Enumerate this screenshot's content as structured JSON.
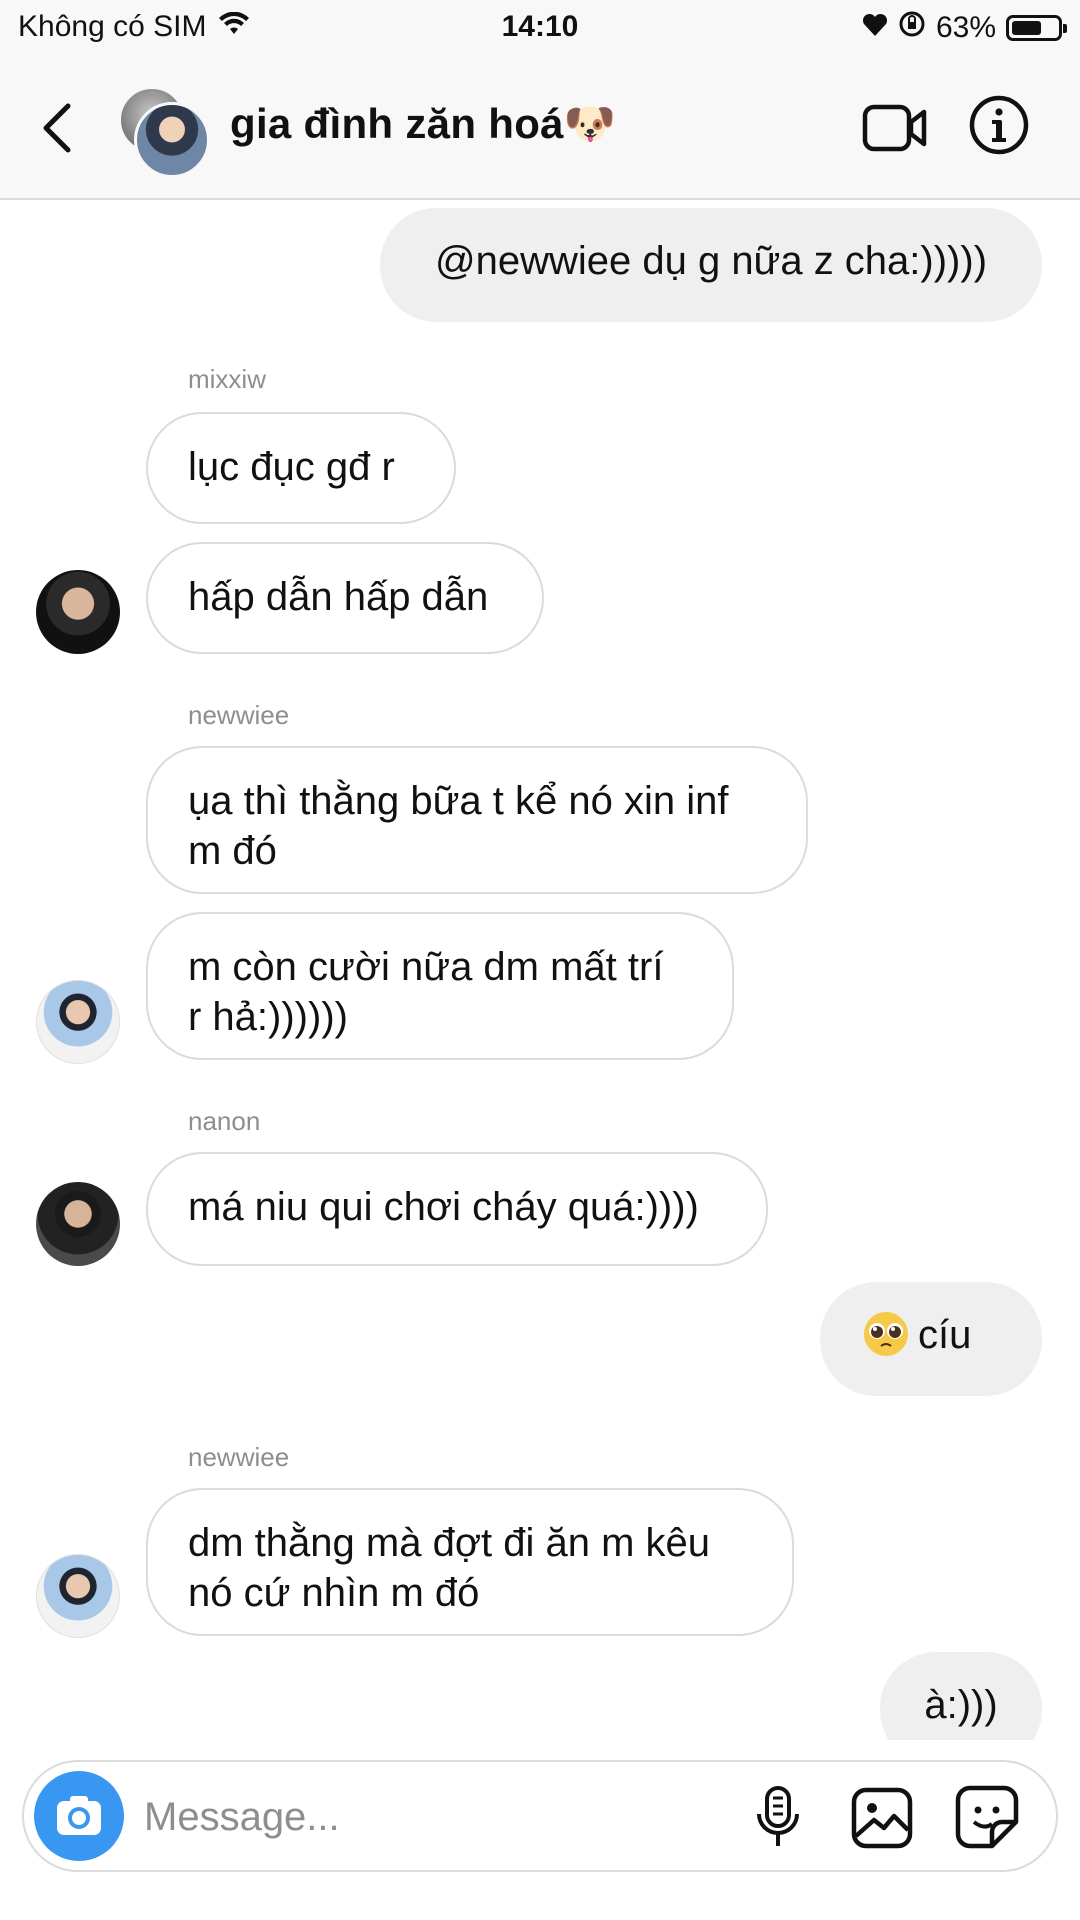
{
  "status_bar": {
    "carrier": "Không có SIM",
    "time": "14:10",
    "battery": "63%"
  },
  "header": {
    "title": "gia đình zăn hoá🐶",
    "icons": [
      "back-chevron-icon",
      "video-camera-icon",
      "info-icon"
    ]
  },
  "messages": [
    {
      "direction": "out",
      "text": "@newwiee dụ g nữa z cha:)))))"
    },
    {
      "sender": "mixxiw"
    },
    {
      "direction": "in",
      "text": "lục đục gđ r"
    },
    {
      "direction": "in",
      "text": "hấp dẫn hấp dẫn"
    },
    {
      "sender": "newwiee"
    },
    {
      "direction": "in",
      "lines": [
        "ụa thì thằng bữa t kể nó xin inf",
        "m đó"
      ]
    },
    {
      "direction": "in",
      "lines": [
        "m còn cười nữa dm mất trí",
        "r hả:))))))"
      ]
    },
    {
      "sender": "nanon"
    },
    {
      "direction": "in",
      "text": "má niu qui chơi cháy quá:))))"
    },
    {
      "direction": "out",
      "text": "cíu",
      "emoji": "pleading-face-emoji"
    },
    {
      "sender": "newwiee"
    },
    {
      "direction": "in",
      "lines": [
        "dm thằng mà đợt đi ăn m kêu",
        "nó cứ nhìn m đó"
      ]
    },
    {
      "direction": "out",
      "text": "à:)))"
    }
  ],
  "composer": {
    "placeholder": "Message...",
    "value": "",
    "camera_color": "#3897f0"
  },
  "colors": {
    "outgoing_bubble": "#efefef",
    "incoming_border": "#dbdbdb",
    "sender_name": "#8e8e8e"
  }
}
